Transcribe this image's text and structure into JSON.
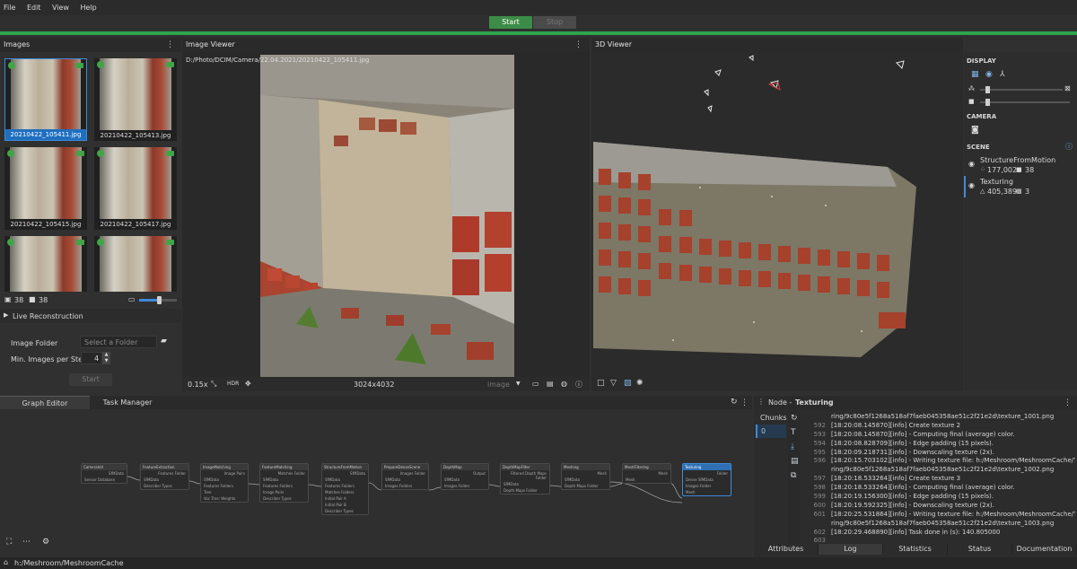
{
  "menu": [
    "File",
    "Edit",
    "View",
    "Help"
  ],
  "toolbar": {
    "start_label": "Start",
    "stop_label": "Stop"
  },
  "images_panel": {
    "title": "Images",
    "thumbs": [
      {
        "name": "20210422_105411.jpg",
        "selected": true
      },
      {
        "name": "20210422_105413.jpg",
        "selected": false
      },
      {
        "name": "20210422_105415.jpg",
        "selected": false
      },
      {
        "name": "20210422_105417.jpg",
        "selected": false
      },
      {
        "name": "",
        "selected": false
      },
      {
        "name": "",
        "selected": false
      }
    ],
    "image_count": "38",
    "camera_count": "38"
  },
  "live_reconstruction": {
    "title": "Live Reconstruction",
    "image_folder_label": "Image Folder",
    "image_folder_placeholder": "Select a Folder",
    "min_images_label": "Min. Images per Step",
    "min_images_value": "4",
    "start_label": "Start"
  },
  "image_viewer": {
    "title": "Image Viewer",
    "path": "D:/Photo/DCIM/Camera/22.04.2021/20210422_105411.jpg",
    "zoom": "0.15x",
    "hdr_label": "HDR",
    "resolution": "3024x4032",
    "mode": "image"
  },
  "viewer3d": {
    "title": "3D Viewer"
  },
  "display_panel": {
    "display_title": "DISPLAY",
    "camera_title": "CAMERA",
    "scene_title": "SCENE",
    "scene_items": [
      {
        "name": "StructureFromMotion",
        "stats_a": "177,002",
        "stats_b": "38"
      },
      {
        "name": "Texturing",
        "stats_a": "405,389",
        "stats_b": "3"
      }
    ]
  },
  "graph_editor": {
    "tabs": [
      "Graph Editor",
      "Task Manager"
    ],
    "nodes": [
      {
        "name": "CameraInit",
        "outputs": "SfMData",
        "params": [
          "Sensor Database"
        ]
      },
      {
        "name": "FeatureExtraction",
        "outputs": "Features Folder",
        "params": [
          "SfMData",
          "Describer Types"
        ]
      },
      {
        "name": "ImageMatching",
        "outputs": "Image Pairs",
        "params": [
          "SfMData",
          "Features Folders",
          "Tree",
          "Voc Tree: Weights"
        ]
      },
      {
        "name": "FeatureMatching",
        "outputs": "Matches Folder",
        "params": [
          "SfMData",
          "Features Folders",
          "Image Pairs",
          "Describer Types"
        ]
      },
      {
        "name": "StructureFromMotion",
        "outputs": "SfMData",
        "params": [
          "SfMData",
          "Features Folders",
          "Matches Folders",
          "Initial Pair A",
          "Initial Pair B",
          "Describer Types"
        ]
      },
      {
        "name": "PrepareDenseScene",
        "outputs": "Images Folder",
        "params": [
          "SfMData",
          "Images Folders"
        ]
      },
      {
        "name": "DepthMap",
        "outputs": "Output",
        "params": [
          "SfMData",
          "Images Folder"
        ]
      },
      {
        "name": "DepthMapFilter",
        "outputs": "Filtered Depth Maps Folder",
        "params": [
          "SfMData",
          "Depth Maps Folder"
        ]
      },
      {
        "name": "Meshing",
        "outputs": "Mesh",
        "params": [
          "SfMData",
          "Depth Maps Folder"
        ]
      },
      {
        "name": "MeshFiltering",
        "outputs": "Mesh",
        "params": [
          "Mesh"
        ]
      },
      {
        "name": "Texturing",
        "outputs": "Folder",
        "params": [
          "Dense SfMData",
          "Images Folder",
          "Mesh"
        ]
      }
    ]
  },
  "node_panel": {
    "title_prefix": "Node - ",
    "title_name": "Texturing",
    "chunks_label": "Chunks",
    "chunk_value": "0",
    "tabs": [
      "Attributes",
      "Log",
      "Statistics",
      "Status",
      "Documentation"
    ],
    "log": [
      {
        "n": "",
        "t": "ring/9c80e5f1268a518af7faeb045358ae51c2f21e2d\\texture_1001.png"
      },
      {
        "n": "592",
        "t": "[18:20:08.145870][info] Create texture 2"
      },
      {
        "n": "593",
        "t": "[18:20:08.145870][info]  - Computing final (average) color."
      },
      {
        "n": "594",
        "t": "[18:20:08.828709][info]  - Edge padding (15 pixels)."
      },
      {
        "n": "595",
        "t": "[18:20:09.218731][info]  - Downscaling texture (2x)."
      },
      {
        "n": "596",
        "t": "[18:20:15.703102][info]  - Writing texture file: h:/Meshroom/MeshroomCache/Textu"
      },
      {
        "n": "",
        "t": "ring/9c80e5f1268a518af7faeb045358ae51c2f21e2d\\texture_1002.png"
      },
      {
        "n": "597",
        "t": "[18:20:18.533264][info] Create texture 3"
      },
      {
        "n": "598",
        "t": "[18:20:18.533264][info]  - Computing final (average) color."
      },
      {
        "n": "599",
        "t": "[18:20:19.156300][info]  - Edge padding (15 pixels)."
      },
      {
        "n": "600",
        "t": "[18:20:19.592325][info]  - Downscaling texture (2x)."
      },
      {
        "n": "601",
        "t": "[18:20:25.531864][info]  - Writing texture file: h:/Meshroom/MeshroomCache/Textu"
      },
      {
        "n": "",
        "t": "ring/9c80e5f1268a518af7faeb045358ae51c2f21e2d\\texture_1003.png"
      },
      {
        "n": "602",
        "t": "[18:20:29.468890][info] Task done in (s): 140.805000"
      },
      {
        "n": "603",
        "t": ""
      }
    ]
  },
  "status_bar": {
    "cache_path": "h:/Meshroom/MeshroomCache"
  },
  "colors": {
    "accent_green": "#41a447",
    "selection_blue": "#1f6fc0",
    "progress": "#2ea44f"
  }
}
